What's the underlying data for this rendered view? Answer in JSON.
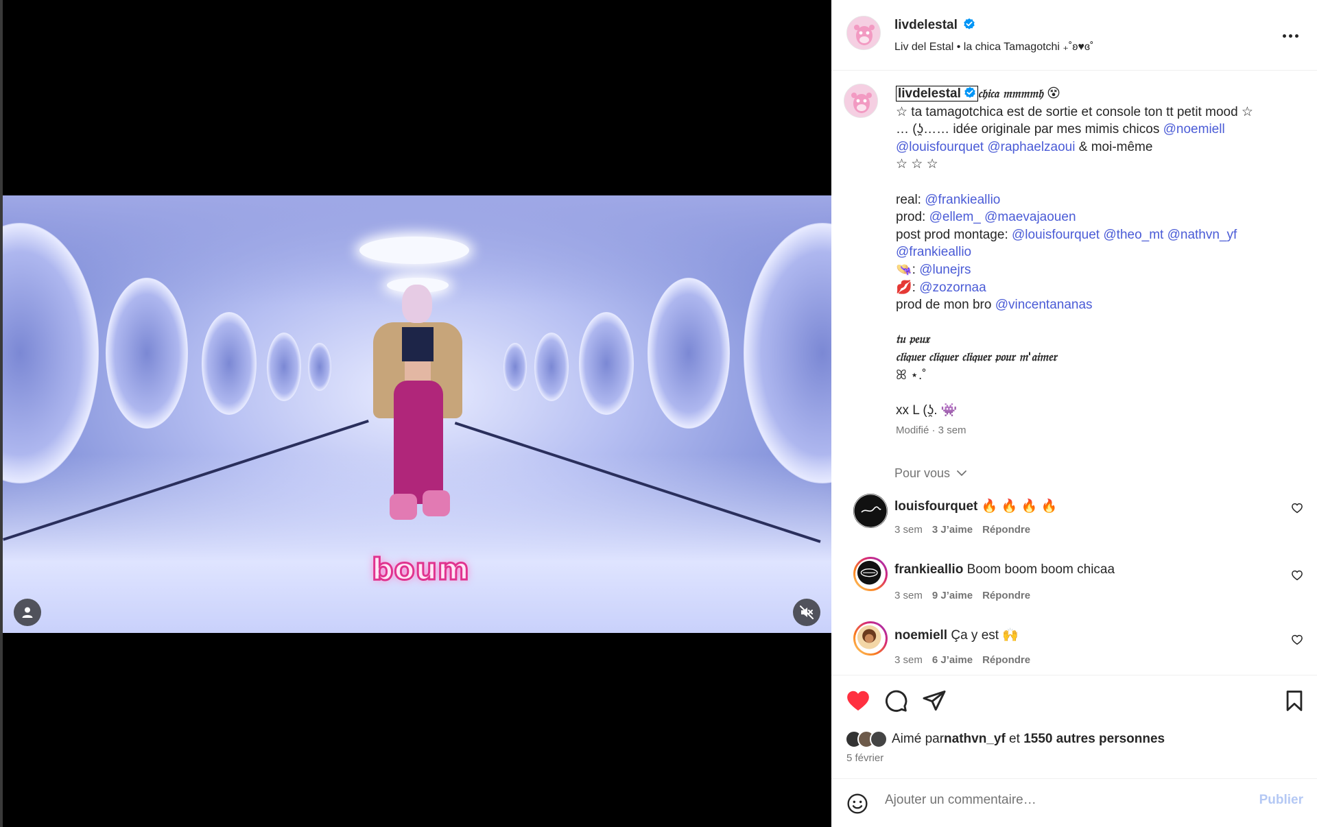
{
  "post": {
    "username": "livdelestal",
    "subtitle": "Liv del Estal • la chica Tamagotchi ₊˚ʚ♥ɞ˚"
  },
  "video": {
    "sticker_text": "boum"
  },
  "caption": {
    "username": "livdelestal",
    "title_fancy": "𝔠𝔥𝔦𝔠𝔞 𝔪𝔪𝔪𝔪𝔥",
    "title_emoji": "😵",
    "line1": "☆ ta tamagotchica est de sortie et console ton tt petit mood ☆",
    "line2_prefix": "… (ʖ̯…… idée originale par mes mimis chicos ",
    "m_noemiell": "@noemiell",
    "m_louisfourquet": "@louisfourquet",
    "m_raphaelzaoui": "@raphaelzaoui",
    "line3_suffix": " & moi-même",
    "stars": "☆ ☆ ☆",
    "real_label": "real: ",
    "m_frankieallio": "@frankieallio",
    "prod_label": "prod: ",
    "m_ellem": "@ellem_",
    "m_maevajaouen": "@maevajaouen",
    "postprod_label": "post prod montage: ",
    "m_theo_mt": "@theo_mt",
    "m_nathvn_yf": "@nathvn_yf",
    "costume_emoji": "👒",
    "m_lunejrs": "@lunejrs",
    "lips_emoji": "💋",
    "m_zozornaa": "@zozornaa",
    "bro_label": "prod de mon bro ",
    "m_vincentananas": "@vincentananas",
    "gothic1": "𝔱𝔲 𝔭𝔢𝔲𝔵",
    "gothic2": "𝔠𝔩𝔦𝔮𝔲𝔢𝔯 𝔠𝔩𝔦𝔮𝔲𝔢𝔯 𝔠𝔩𝔦𝔮𝔲𝔢𝔯 𝔭𝔬𝔲𝔯 𝔪'𝔞𝔦𝔪𝔢𝔯",
    "sparkle": "ꕤ ⋆.˚",
    "signoff": "xx L (ʖ̯. 👾",
    "modified": "Modifié · 3 sem"
  },
  "filter_label": "Pour vous",
  "comments": [
    {
      "user": "louisfourquet",
      "text": "🔥 🔥 🔥 🔥",
      "time": "3 sem",
      "likes": "3 J’aime",
      "reply": "Répondre"
    },
    {
      "user": "frankieallio",
      "text": "Boom boom boom chicaa",
      "time": "3 sem",
      "likes": "9 J’aime",
      "reply": "Répondre"
    },
    {
      "user": "noemiell",
      "text": "Ça y est 🙌",
      "time": "3 sem",
      "likes": "6 J’aime",
      "reply": "Répondre"
    }
  ],
  "likes": {
    "prefix": "Aimé par ",
    "user": "nathvn_yf",
    "middle": " et ",
    "others": "1550 autres personnes"
  },
  "date": "5 février",
  "comment_box": {
    "placeholder": "Ajouter un commentaire…",
    "publish": "Publier"
  },
  "colors": {
    "accent_link": "#4a5bd6",
    "like_red": "#ff3040",
    "verified_blue": "#0095f6",
    "publish_disabled": "#b4c8f4"
  }
}
